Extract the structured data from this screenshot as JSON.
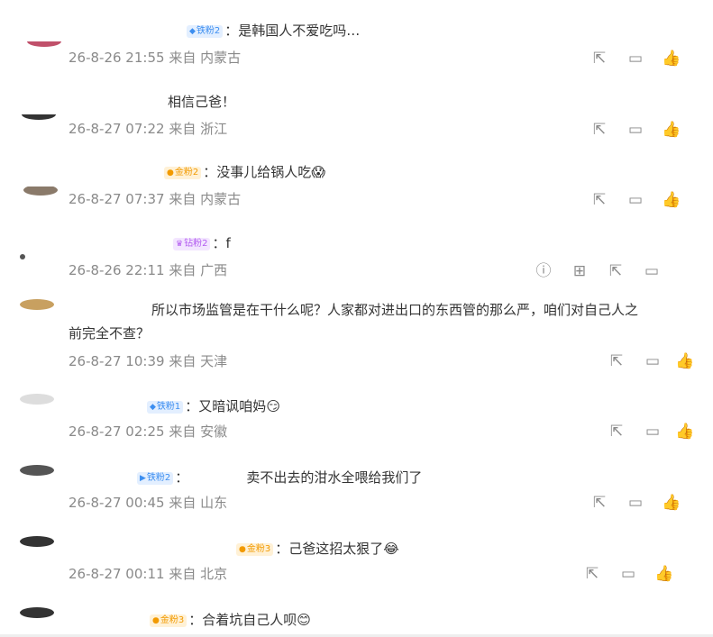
{
  "comments": [
    {
      "badge": "铁粉2",
      "text": "：是韩国人不爱吃吗…",
      "time": "26-8-26 21:55",
      "source": "来自 内蒙古"
    },
    {
      "badge": "",
      "text": "相信己爸！",
      "time": "26-8-27 07:22",
      "source": "来自 浙江"
    },
    {
      "badge": "金粉2",
      "text": "：没事儿给锅人吃",
      "emoji": "😱",
      "time": "26-8-27 07:37",
      "source": "来自 内蒙古"
    },
    {
      "badge": "钻粉2",
      "text": "：f",
      "time": "26-8-26 22:11",
      "source": "来自 广西"
    },
    {
      "badge": "",
      "text": "所以市场监管是在干什么呢？人家都对进出口的东西管的那么严，咱们对自己人之",
      "text2": "前完全不查？",
      "time": "26-8-27 10:39",
      "source": "来自 天津"
    },
    {
      "badge": "铁粉1",
      "text": "：又暗讽咱妈",
      "emoji": "😏",
      "time": "26-8-27 02:25",
      "source": "来自 安徽"
    },
    {
      "badge": "铁粉2",
      "text": "：",
      "text_b": "卖不出去的泔水全喂给我们了",
      "time": "26-8-27 00:45",
      "source": "来自 山东"
    },
    {
      "badge": "金粉3",
      "text": "：己爸这招太狠了",
      "emoji": "😂",
      "time": "26-8-27 00:11",
      "source": "来自 北京"
    },
    {
      "badge": "金粉3",
      "text": "：合着坑自己人呗",
      "emoji": "😊"
    }
  ],
  "icons": {
    "share": "share-icon",
    "comment": "comment-icon",
    "like": "like-icon",
    "report": "report-icon",
    "translate": "translate-icon"
  }
}
